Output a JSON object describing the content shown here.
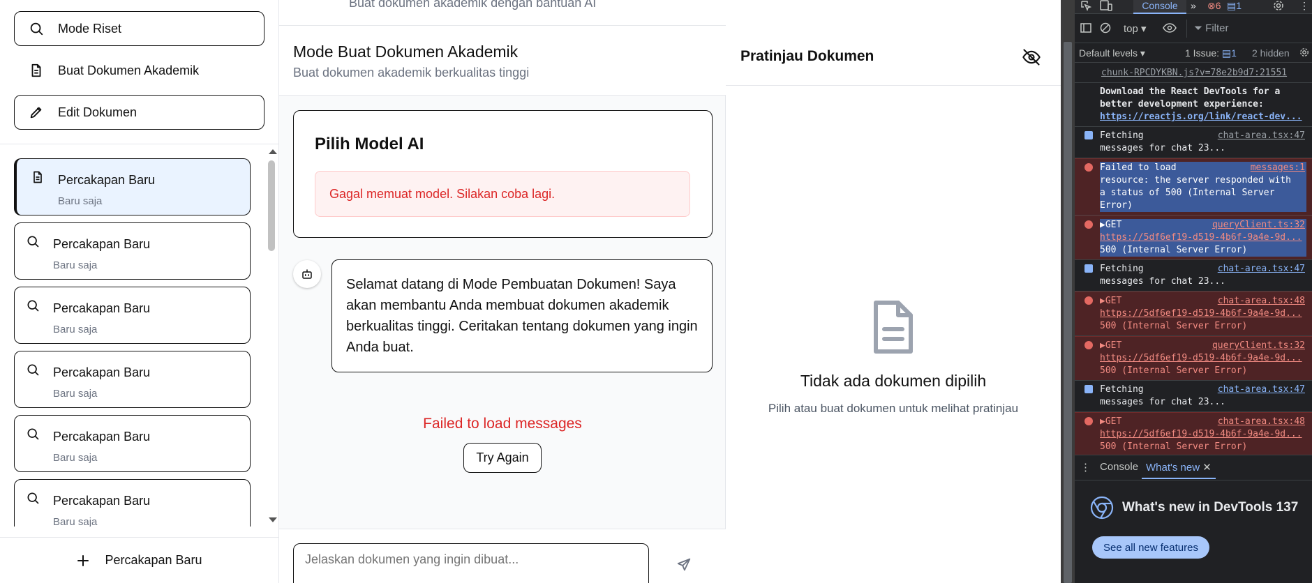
{
  "sidebar": {
    "modes": [
      {
        "label": "Mode Riset",
        "icon": "search-icon"
      },
      {
        "label": "Buat Dokumen Akademik",
        "icon": "file-text-icon"
      },
      {
        "label": "Edit Dokumen",
        "icon": "pencil-icon"
      }
    ],
    "chats": [
      {
        "title": "Percakapan Baru",
        "time": "Baru saja",
        "icon": "file-text-icon",
        "active": true
      },
      {
        "title": "Percakapan Baru",
        "time": "Baru saja",
        "icon": "search-icon"
      },
      {
        "title": "Percakapan Baru",
        "time": "Baru saja",
        "icon": "search-icon"
      },
      {
        "title": "Percakapan Baru",
        "time": "Baru saja",
        "icon": "search-icon"
      },
      {
        "title": "Percakapan Baru",
        "time": "Baru saja",
        "icon": "search-icon"
      },
      {
        "title": "Percakapan Baru",
        "time": "Baru saja",
        "icon": "search-icon"
      }
    ],
    "new_chat_label": "Percakapan Baru"
  },
  "main": {
    "top_strip": "Buat dokumen akademik dengan bantuan AI",
    "title": "Mode Buat Dokumen Akademik",
    "subtitle": "Buat dokumen akademik berkualitas tinggi",
    "model_card": {
      "title": "Pilih Model AI",
      "error": "Gagal memuat model. Silakan coba lagi."
    },
    "message": "Selamat datang di Mode Pembuatan Dokumen! Saya akan membantu Anda membuat dokumen akademik berkualitas tinggi. Ceritakan tentang dokumen yang ingin Anda buat.",
    "fail_text": "Failed to load messages",
    "try_again": "Try Again",
    "input_placeholder": "Jelaskan dokumen yang ingin dibuat..."
  },
  "preview": {
    "title": "Pratinjau Dokumen",
    "empty_title": "Tidak ada dokumen dipilih",
    "empty_subtitle": "Pilih atau buat dokumen untuk melihat pratinjau"
  },
  "devtools": {
    "tab_console": "Console",
    "error_count": "6",
    "message_count": "1",
    "context": "top",
    "filter_placeholder": "Filter",
    "levels": "Default levels",
    "issues": "1 Issue:",
    "issues_count": "1",
    "hidden": "2 hidden",
    "logs": [
      {
        "type": "plain",
        "text": "chunk-RPCDYKBN.js?v=78e2b9d7:21551"
      },
      {
        "type": "plain-bold",
        "text": "Download the React DevTools for a\nbetter development experience:",
        "link": "https://reactjs.org/link/react-dev..."
      },
      {
        "type": "info",
        "text": "Fetching\nmessages for chat 23...",
        "src": "chat-area.tsx:47"
      },
      {
        "type": "err",
        "text": "Failed to load\nresource: the server responded with\na status of 500 (Internal Server\nError)",
        "src": "messages:1"
      },
      {
        "type": "err",
        "text": "▶GET",
        "link": "https://5df6ef19-d519-4b6f-9a4e-9d...",
        "tail": "500 (Internal Server Error)",
        "src": "queryClient.ts:32"
      },
      {
        "type": "info",
        "text": "Fetching\nmessages for chat 23...",
        "src": "chat-area.tsx:47"
      },
      {
        "type": "err",
        "text": "▶GET",
        "link": "https://5df6ef19-d519-4b6f-9a4e-9d...",
        "tail": "500 (Internal Server Error)",
        "src": "chat-area.tsx:48"
      },
      {
        "type": "err",
        "text": "▶GET",
        "link": "https://5df6ef19-d519-4b6f-9a4e-9d...",
        "tail": "500 (Internal Server Error)",
        "src": "queryClient.ts:32"
      },
      {
        "type": "info",
        "text": "Fetching\nmessages for chat 23...",
        "src": "chat-area.tsx:47"
      },
      {
        "type": "err",
        "text": "▶GET",
        "link": "https://5df6ef19-d519-4b6f-9a4e-9d...",
        "tail": "500 (Internal Server Error)",
        "src": "chat-area.tsx:48"
      }
    ],
    "drawer_tab_console": "Console",
    "drawer_tab_whatsnew": "What's new",
    "whatsnew_title": "What's new in DevTools 137",
    "see_all": "See all new features"
  },
  "colors": {
    "accent": "#111111",
    "active_chat_bg": "#eaf3ff",
    "error_red": "#dc2626",
    "devtools_bg": "#202124",
    "devtools_link": "#8ab4f8"
  }
}
